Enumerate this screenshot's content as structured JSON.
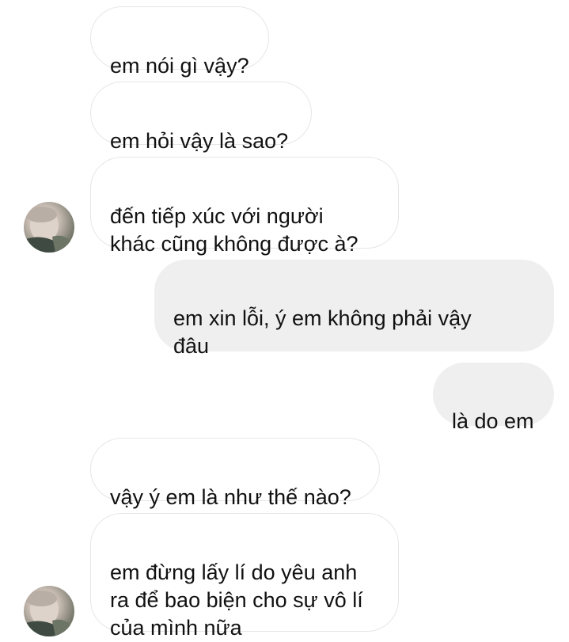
{
  "messages": [
    {
      "id": "m1",
      "side": "received",
      "text": "em nói gì vậy?"
    },
    {
      "id": "m2",
      "side": "received",
      "text": "em hỏi vậy là sao?"
    },
    {
      "id": "m3",
      "side": "received",
      "text": "đến tiếp xúc với người\nkhác cũng không được à?"
    },
    {
      "id": "m4",
      "side": "sent",
      "text": "em xin lỗi, ý em không phải vậy\nđâu"
    },
    {
      "id": "m5",
      "side": "sent",
      "text": "là do em"
    },
    {
      "id": "m6",
      "side": "received",
      "text": "vậy ý em là như thế nào?"
    },
    {
      "id": "m7",
      "side": "received",
      "text": "em đừng lấy lí do yêu anh\nra để bao biện cho sự vô lí\ncủa mình nữa"
    }
  ],
  "colors": {
    "sent_bubble": "#efefef",
    "received_bubble": "#ffffff",
    "received_border": "#e6e6e6",
    "text": "#111111"
  },
  "icons": {
    "avatar": "contact-avatar-photo"
  }
}
